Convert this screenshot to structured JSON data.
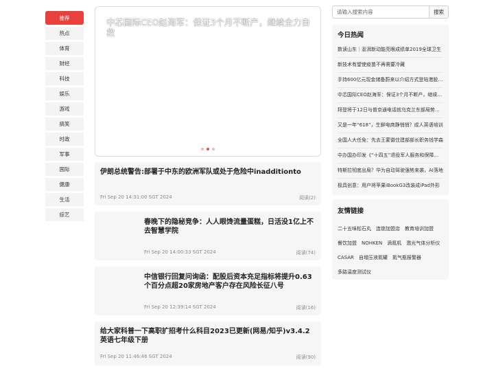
{
  "nav": {
    "items": [
      {
        "label": "推荐",
        "active": true
      },
      {
        "label": "热点"
      },
      {
        "label": "体育"
      },
      {
        "label": "财经"
      },
      {
        "label": "科技"
      },
      {
        "label": "娱乐"
      },
      {
        "label": "游戏"
      },
      {
        "label": "搞笑"
      },
      {
        "label": "时政"
      },
      {
        "label": "军事"
      },
      {
        "label": "国际"
      },
      {
        "label": "健康"
      },
      {
        "label": "生活"
      },
      {
        "label": "综艺"
      }
    ]
  },
  "banner": {
    "title": "中芯国际CEO赵海军：保证3个月不断产，继续全力自救",
    "active_slide": 2,
    "slide_count": 3
  },
  "articles": [
    {
      "title": "伊朗总统警告:部署于中东的欧洲军队或处于危险中inadditionto",
      "date": "Fri Sep 20 14:31:00 SGT 2024",
      "reads": "阅读(2)"
    },
    {
      "title": "春晚下的隐秘竞争：人人眼馋流量蛋糕，日活没1亿上不去智慧学院",
      "date": "Fri Sep 20 14:00:33 SGT 2024",
      "reads": "阅读(74)"
    },
    {
      "title": "中信银行回复问询函：配股后资本充足指标将提升0.63个百分点超20家房地产客户存在风险长征八号",
      "date": "Fri Sep 20 12:39:14 SGT 2024",
      "reads": "阅读(16)"
    },
    {
      "title": "给大家科普一下高职扩招考什么科目2023已更新(网易/知乎)v3.4.2英语七年级下册",
      "date": "Fri Sep 20 11:46:46 SGT 2024",
      "reads": "阅读(90)"
    }
  ],
  "search": {
    "placeholder": "请输入搜索内容",
    "button_label": "搜索"
  },
  "hot": {
    "title": "今日热闻",
    "items": [
      "数读山东｜澎湃新动能亮眼成绩单2019全球卫生",
      "新技术有望使疫苗不再需要冷藏",
      "手持600亿元现金储备蔚来以介绍方式登陆港股市场",
      "中芯国际CEO赵海军：保证3个月不断产，继续全力自救",
      "拜登将于12日与普京通电话就乌克兰东部局势进行讨论",
      "又是一年“618”，生鲜电商静悄悄？成人英语培训",
      "全国人大任免：先去王蒙徽住建部部长职务钱学森",
      "中办国办印发《“十四五”退役军人服务和保障规划》",
      "特斯拉彻底出局？华为自动驾驶强势来袭，AI落地",
      "极具创意：用户将苹果iBookG3改装成iPad外形"
    ]
  },
  "links": {
    "title": "友情链接",
    "items": [
      "二十五味松石丸",
      "连锁加盟店",
      "教育培训加盟",
      "餐饮加盟",
      "NOHKEN",
      "滴氮机",
      "激光气体分析仪",
      "CASAR",
      "自增压液氮罐",
      "氮气瓶报警器",
      "多路温度测试仪"
    ]
  }
}
